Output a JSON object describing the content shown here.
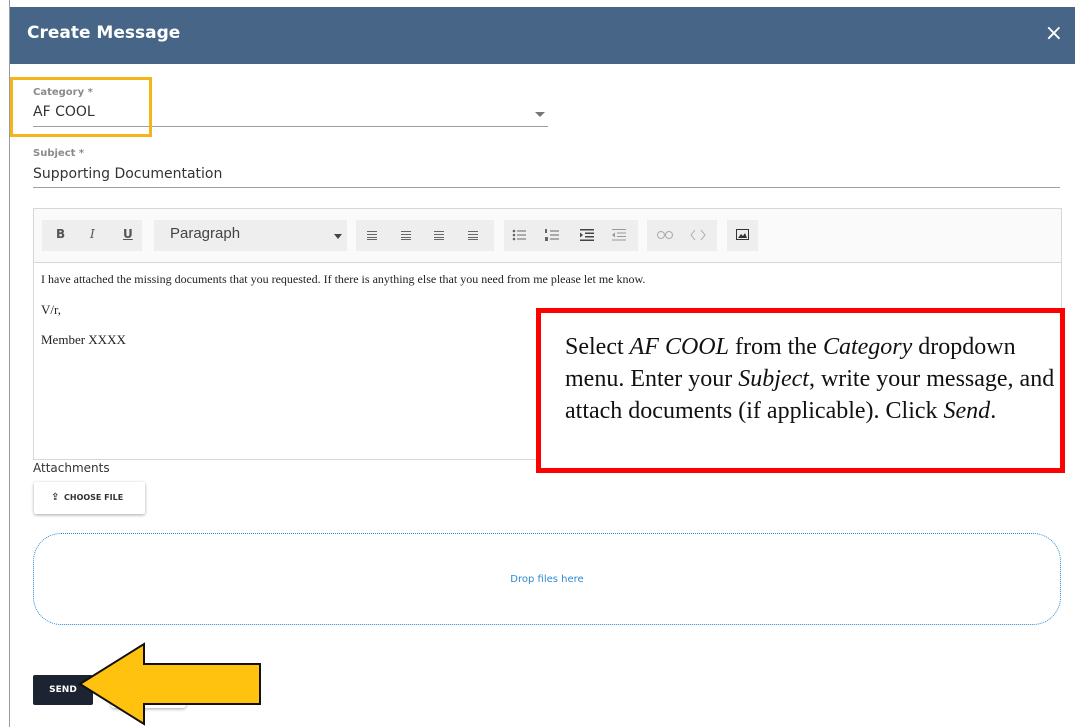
{
  "dialog": {
    "title": "Create Message",
    "close_icon": "×"
  },
  "category": {
    "label": "Category *",
    "value": "AF COOL"
  },
  "subject": {
    "label": "Subject *",
    "value": "Supporting Documentation"
  },
  "editor": {
    "toolbar": {
      "bold": "B",
      "italic": "I",
      "underline": "U",
      "format_select": "Paragraph",
      "icons": [
        "align-left-icon",
        "align-center-icon",
        "align-right-icon",
        "align-justify-icon",
        "bullet-list-icon",
        "numbered-list-icon",
        "indent-icon",
        "outdent-icon",
        "link-icon",
        "unlink-icon",
        "image-icon"
      ]
    },
    "body": {
      "line1": "I have attached the missing documents that you requested. If there is anything else that you need from me please let me know.",
      "line2": "V/r,",
      "line3": "Member XXXX"
    }
  },
  "attachments": {
    "label": "Attachments",
    "choose_file": "CHOOSE FILE",
    "drop_text": "Drop files here"
  },
  "actions": {
    "send": "SEND"
  },
  "annotation": {
    "t1": "Select ",
    "e1": "AF COOL",
    "t2": " from the ",
    "e2": "Category",
    "t3": " dropdown menu. Enter your ",
    "e3": "Subject",
    "t4": ", write your message, and attach documents (if applicable). Click ",
    "e4": "Send",
    "t5": "."
  },
  "colors": {
    "header": "#466587",
    "highlight_box": "#f4b41a",
    "callout_border": "#ff0000",
    "arrow_fill": "#ffc20e",
    "dropzone_accent": "#2e8bd0",
    "send_button": "#1b2430"
  }
}
